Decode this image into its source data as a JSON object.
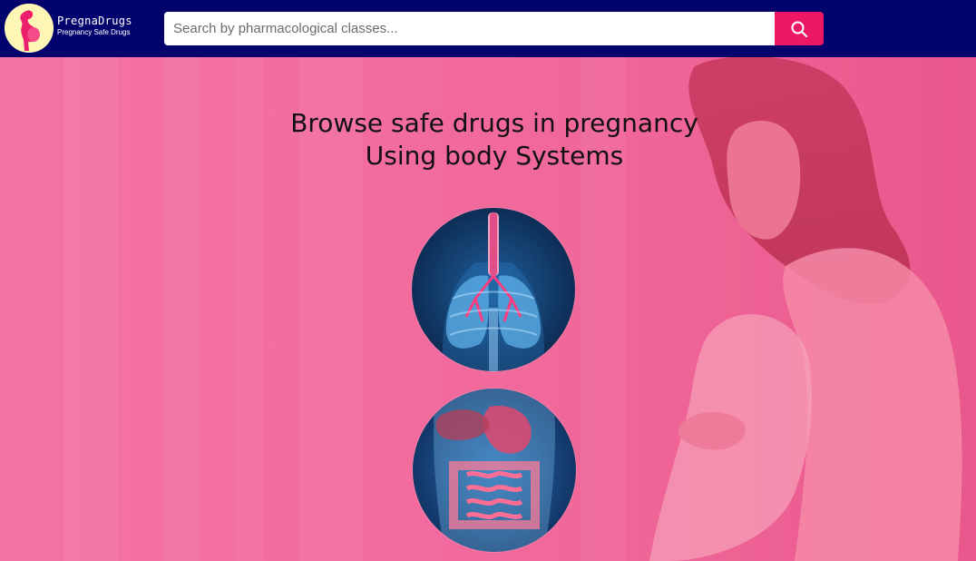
{
  "brand": {
    "name": "PregnaDrugs",
    "tagline": "Pregnancy Safe Drugs",
    "logo_icon": "pregnant-woman-silhouette-icon"
  },
  "search": {
    "placeholder": "Search by pharmacological classes...",
    "value": "",
    "button_icon": "search-icon"
  },
  "hero": {
    "title_line1": "Browse safe drugs in pregnancy",
    "title_line2": "Using body Systems",
    "systems": [
      {
        "name": "respiratory-system",
        "icon": "lungs-icon"
      },
      {
        "name": "digestive-system",
        "icon": "intestines-icon"
      }
    ]
  },
  "colors": {
    "navbar": "#03036e",
    "accent": "#ee1763",
    "hero_overlay": "#f26ea0",
    "logo_bg": "#fdf6b5"
  }
}
